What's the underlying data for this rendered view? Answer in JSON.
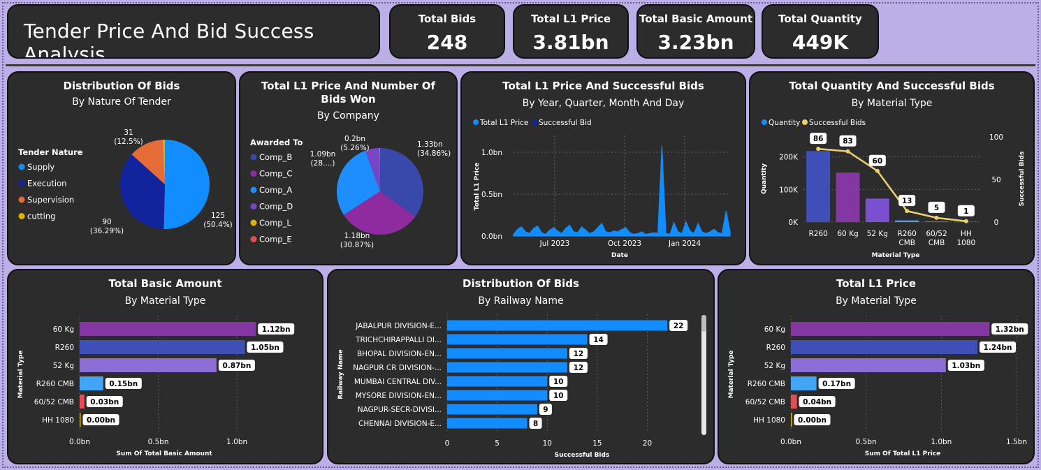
{
  "page_title": "Tender Price And Bid Success Analysis",
  "kpis": [
    {
      "label": "Total Bids",
      "value": "248"
    },
    {
      "label": "Total L1 Price",
      "value": "3.81bn"
    },
    {
      "label": "Total Basic Amount",
      "value": "3.23bn"
    },
    {
      "label": "Total Quantity",
      "value": "449K"
    }
  ],
  "cards": {
    "nature": {
      "title": "Distribution Of Bids",
      "subtitle": "By Nature Of Tender"
    },
    "company": {
      "title": "Total L1 Price And Number Of Bids Won",
      "subtitle": "By Company"
    },
    "trend": {
      "title": "Total L1 Price And Successful Bids",
      "subtitle": "By Year, Quarter, Month And Day"
    },
    "quantity": {
      "title": "Total Quantity And Successful Bids",
      "subtitle": "By Material Type"
    },
    "basic": {
      "title": "Total Basic Amount",
      "subtitle": "By Material Type"
    },
    "railway": {
      "title": "Distribution Of Bids",
      "subtitle": "By Railway Name"
    },
    "l1": {
      "title": "Total L1 Price",
      "subtitle": "By Material Type"
    }
  },
  "chart_data": [
    {
      "id": "nature",
      "type": "pie",
      "legend_title": "Tender Nature",
      "legend_position": "left",
      "labels": [
        "Supply",
        "Execution",
        "Supervision",
        "cutting"
      ],
      "values": [
        125,
        90,
        31,
        2
      ],
      "colors": [
        "#118dff",
        "#12239e",
        "#e66c37",
        "#d9b300"
      ],
      "data_labels": [
        "125\n(50.4%)",
        "90\n(36.29%)",
        "31\n(12.5%)",
        ""
      ]
    },
    {
      "id": "company",
      "type": "pie",
      "legend_title": "Awarded To",
      "legend_position": "left",
      "labels": [
        "Comp_B",
        "Comp_C",
        "Comp_A",
        "Comp_D",
        "Comp_L",
        "Comp_E"
      ],
      "values": [
        1.33,
        1.18,
        1.09,
        0.2,
        0.005,
        0.005
      ],
      "colors": [
        "#3949ab",
        "#8e2c9f",
        "#1e8eff",
        "#7a45c4",
        "#d9b300",
        "#e04e56"
      ],
      "data_labels": [
        "1.33bn\n(34.86%)",
        "1.18bn\n(30.87%)",
        "1.09bn\n(28....)",
        "0.2bn\n(5.26%)",
        "",
        ""
      ]
    },
    {
      "id": "trend",
      "type": "area",
      "legend_position": "top-left",
      "series": [
        {
          "name": "Total L1 Price",
          "color": "#118dff",
          "values": [
            0.02,
            0.08,
            0.11,
            0.05,
            0.03,
            0.09,
            0.12,
            0.04,
            0.02,
            0.07,
            0.1,
            0.06,
            0.03,
            0.09,
            0.13,
            0.05,
            0.04,
            0.11,
            0.07,
            0.03,
            0.05,
            0.1,
            0.15,
            0.05,
            0.04,
            0.06,
            0.05,
            0.08,
            0.1,
            0.04,
            0.02,
            0.03,
            0.05,
            0.02,
            0.03,
            0.04,
            0.03,
            1.08,
            0.03,
            0.02,
            0.16,
            0.05,
            0.03,
            0.17,
            0.06,
            0.03,
            0.15,
            0.05,
            0.03,
            0.05,
            0.08,
            0.04,
            0.03,
            0.3,
            0.05
          ]
        },
        {
          "name": "Successful Bid",
          "color": "#12239e",
          "values": []
        }
      ],
      "xlabel": "Date",
      "ylabel": "Total L1 Price",
      "x_ticks": [
        "Jul 2023",
        "Oct 2023",
        "Jan 2024"
      ],
      "y_ticks": [
        "0.0bn",
        "0.5bn",
        "1.0bn"
      ],
      "ylim": [
        0,
        1.2
      ],
      "grid": true
    },
    {
      "id": "quantity",
      "type": "bar",
      "categories": [
        "R260",
        "60 Kg",
        "52 Kg",
        "R260 CMB",
        "60/52 CMB",
        "HH 1080"
      ],
      "category_lines": [
        [
          "R260"
        ],
        [
          "60 Kg"
        ],
        [
          "52 Kg"
        ],
        [
          "R260",
          "CMB"
        ],
        [
          "60/52",
          "CMB"
        ],
        [
          "HH",
          "1080"
        ]
      ],
      "series": [
        {
          "name": "Quantity",
          "axis": "left",
          "values": [
            218000,
            152000,
            72000,
            5000,
            2000,
            500
          ],
          "colors": [
            "#3f4fb8",
            "#8436a3",
            "#7a4fd0",
            "#42a5f5",
            "#e04e56",
            "#d9b300"
          ]
        },
        {
          "name": "Successful Bids",
          "axis": "right",
          "type": "line",
          "color": "#e9d26b",
          "values": [
            86,
            83,
            60,
            13,
            5,
            1
          ]
        }
      ],
      "xlabel": "Material Type",
      "ylabel": "Quantity",
      "y2label": "Successful Bids",
      "y_ticks": [
        "0K",
        "100K",
        "200K"
      ],
      "y2_ticks": [
        "0",
        "50",
        "100"
      ],
      "ylim": [
        0,
        270000
      ],
      "y2lim": [
        0,
        100
      ],
      "legend_position": "top-left"
    },
    {
      "id": "basic",
      "type": "bar",
      "orientation": "horizontal",
      "categories": [
        "60 Kg",
        "R260",
        "52 Kg",
        "R260 CMB",
        "60/52 CMB",
        "HH 1080"
      ],
      "values": [
        1.12,
        1.05,
        0.87,
        0.15,
        0.03,
        0.0
      ],
      "data_labels": [
        "1.12bn",
        "1.05bn",
        "0.87bn",
        "0.15bn",
        "0.03bn",
        "0.00bn"
      ],
      "colors": [
        "#8436a3",
        "#3f4fb8",
        "#8c6fd6",
        "#42a5f5",
        "#e04e56",
        "#d9b300"
      ],
      "xlabel": "Sum Of Total Basic Amount",
      "ylabel": "Material Type",
      "x_ticks": [
        "0.0bn",
        "0.5bn",
        "1.0bn"
      ],
      "xlim": [
        0,
        1.35
      ],
      "grid": true
    },
    {
      "id": "railway",
      "type": "bar",
      "orientation": "horizontal",
      "categories": [
        "JABALPUR DIVISION-E...",
        "TRICHCHIRAPPALLI DI...",
        "BHOPAL DIVISION-EN...",
        "NAGPUR CR DIVISION-...",
        "MUMBAI CENTRAL DIV...",
        "MYSORE DIVISION-EN...",
        "NAGPUR-SECR-DIVISI...",
        "CHENNAI DIVISION-E..."
      ],
      "values": [
        22,
        14,
        12,
        12,
        10,
        10,
        9,
        8
      ],
      "color": "#118dff",
      "xlabel": "Successful Bids",
      "ylabel": "Railway Name",
      "x_ticks": [
        "0",
        "5",
        "10",
        "15",
        "20"
      ],
      "xlim": [
        0,
        24.5
      ],
      "grid": true
    },
    {
      "id": "l1",
      "type": "bar",
      "orientation": "horizontal",
      "categories": [
        "60 Kg",
        "R260",
        "52 Kg",
        "R260 CMB",
        "60/52 CMB",
        "HH 1080"
      ],
      "values": [
        1.32,
        1.24,
        1.03,
        0.17,
        0.04,
        0.0
      ],
      "data_labels": [
        "1.32bn",
        "1.24bn",
        "1.03bn",
        "0.17bn",
        "0.04bn",
        "0.00bn"
      ],
      "colors": [
        "#8436a3",
        "#3f4fb8",
        "#8c6fd6",
        "#42a5f5",
        "#e04e56",
        "#d9b300"
      ],
      "xlabel": "Sum Of Total L1 Price",
      "ylabel": "Material Type",
      "x_ticks": [
        "0.0bn",
        "0.5bn",
        "1.0bn",
        "1.5bn"
      ],
      "xlim": [
        0,
        1.5
      ],
      "grid": true
    }
  ]
}
